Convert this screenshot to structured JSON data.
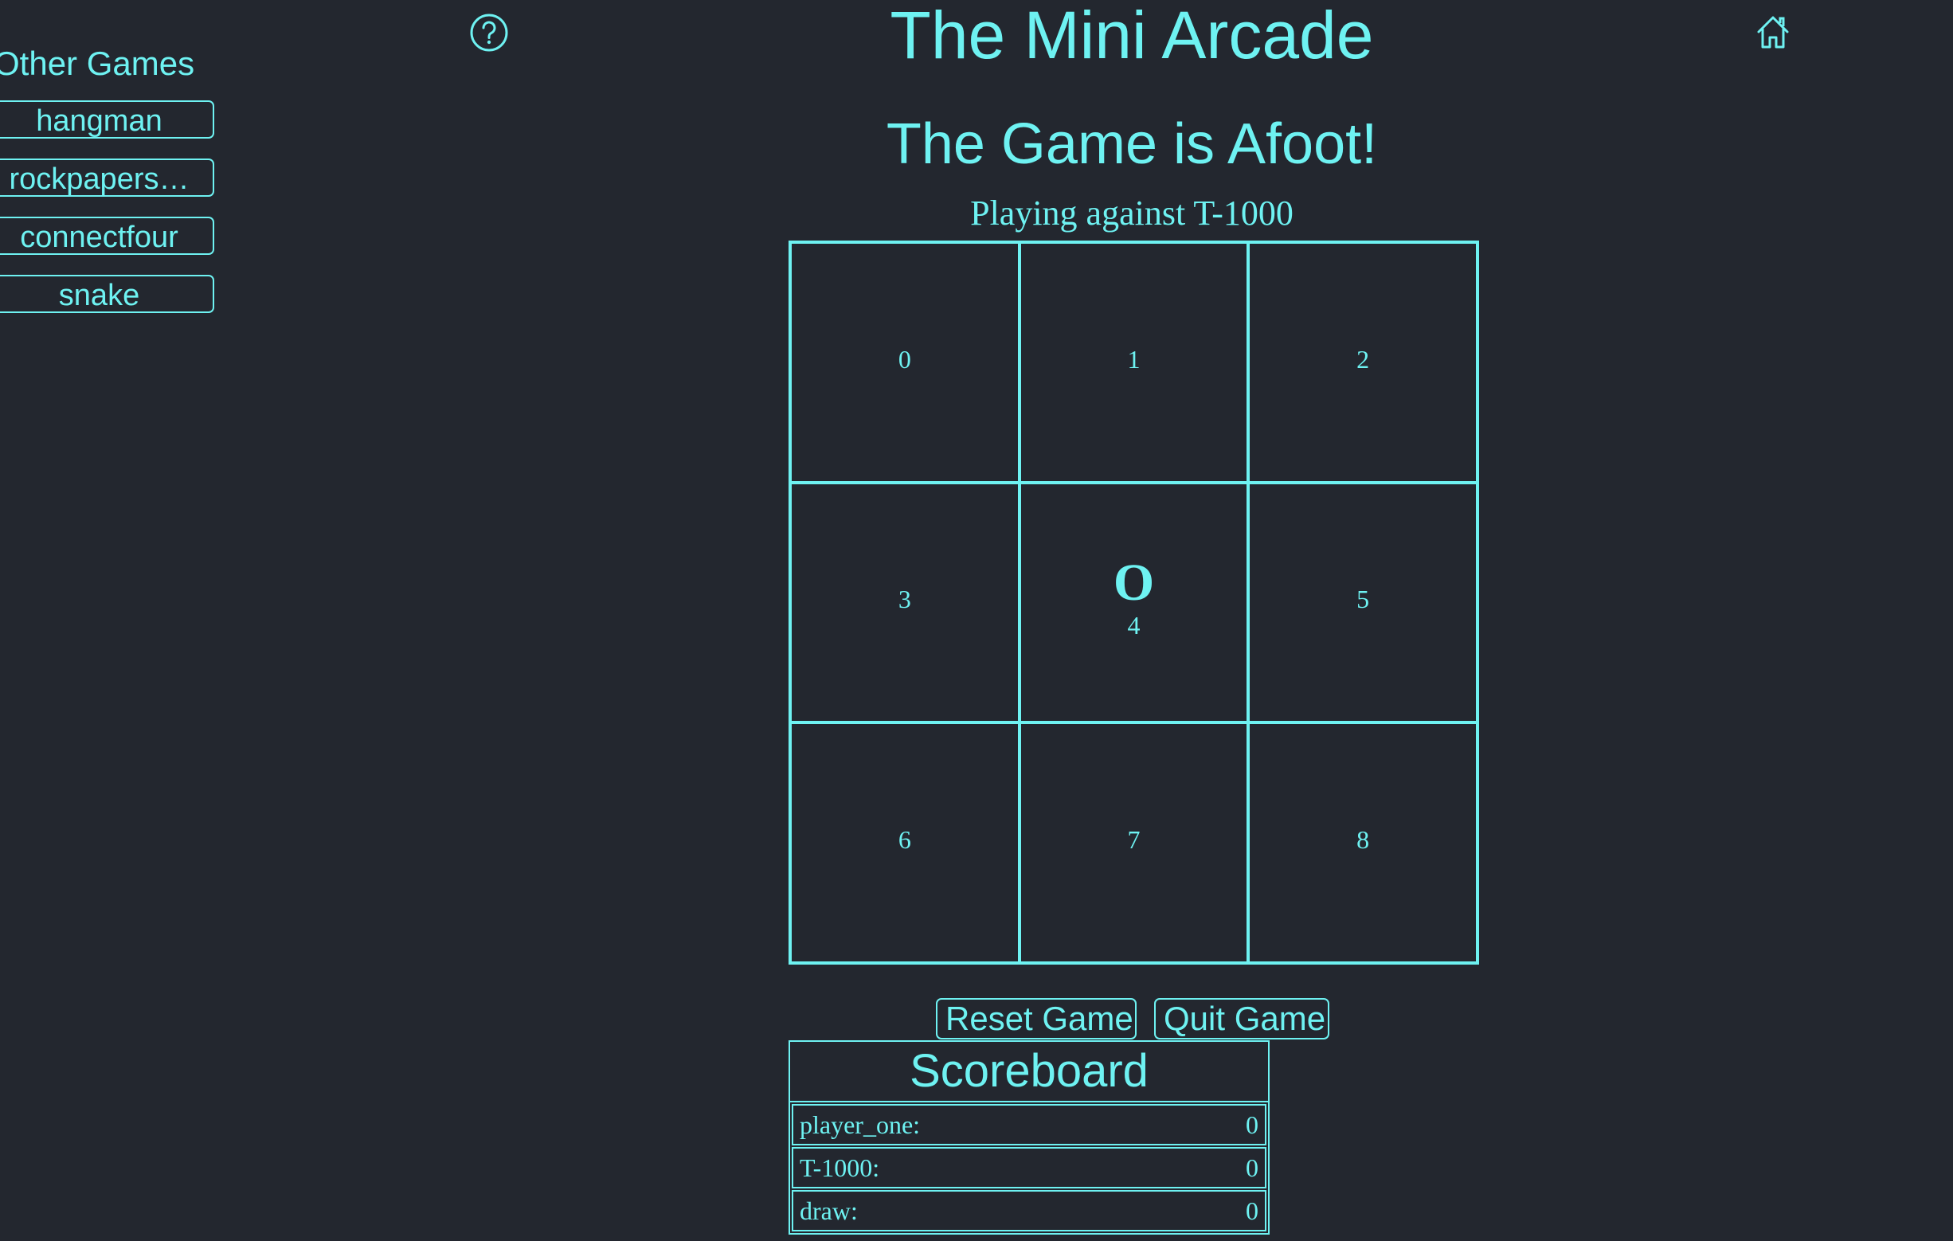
{
  "sidebar": {
    "title": "Other Games",
    "games": [
      {
        "label": "hangman"
      },
      {
        "label": "rockpapers…"
      },
      {
        "label": "connectfour"
      },
      {
        "label": "snake"
      }
    ]
  },
  "header": {
    "title": "The Mini Arcade",
    "help_icon": "question-circle-icon",
    "home_icon": "home-icon"
  },
  "game": {
    "status": "The Game is Afoot!",
    "opponent_text": "Playing against T-1000",
    "cells": [
      {
        "index": "0",
        "mark": ""
      },
      {
        "index": "1",
        "mark": ""
      },
      {
        "index": "2",
        "mark": ""
      },
      {
        "index": "3",
        "mark": ""
      },
      {
        "index": "4",
        "mark": "O"
      },
      {
        "index": "5",
        "mark": ""
      },
      {
        "index": "6",
        "mark": ""
      },
      {
        "index": "7",
        "mark": ""
      },
      {
        "index": "8",
        "mark": ""
      }
    ]
  },
  "actions": {
    "reset_label": "Reset Game",
    "quit_label": "Quit Game"
  },
  "scoreboard": {
    "title": "Scoreboard",
    "rows": [
      {
        "label": "player_one:",
        "value": "0"
      },
      {
        "label": "T-1000:",
        "value": "0"
      },
      {
        "label": "draw:",
        "value": "0"
      }
    ]
  },
  "colors": {
    "background": "#23272f",
    "accent": "#6ef2f2"
  }
}
